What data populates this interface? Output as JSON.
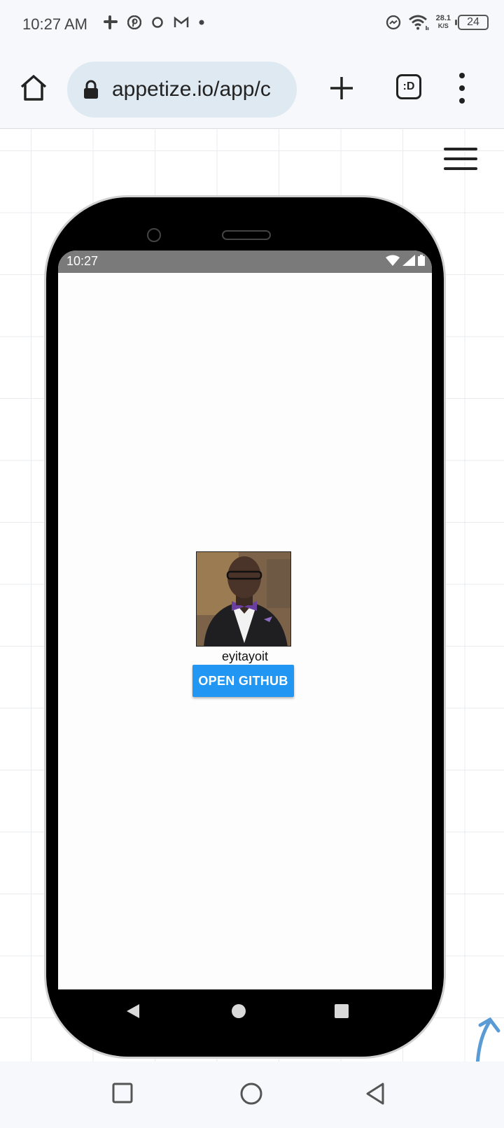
{
  "status_bar": {
    "time": "10:27 AM",
    "notification_icons": [
      "slack-icon",
      "pinterest-icon",
      "sync-icon",
      "gmail-icon",
      "dot-icon"
    ],
    "net_speed_value": "28.1",
    "net_speed_unit": "K/S",
    "battery": "24"
  },
  "browser": {
    "url": "appetize.io/app/c",
    "tabs_label": ":D"
  },
  "emulator": {
    "status_time": "10:27",
    "profile": {
      "username": "eyitayoit",
      "button_label": "OPEN GITHUB"
    }
  },
  "colors": {
    "button": "#2196f3",
    "inner_status_bar": "#7a7a7a",
    "url_bar": "#dfe9f1",
    "scroll_arrow": "#5b9bd5"
  }
}
